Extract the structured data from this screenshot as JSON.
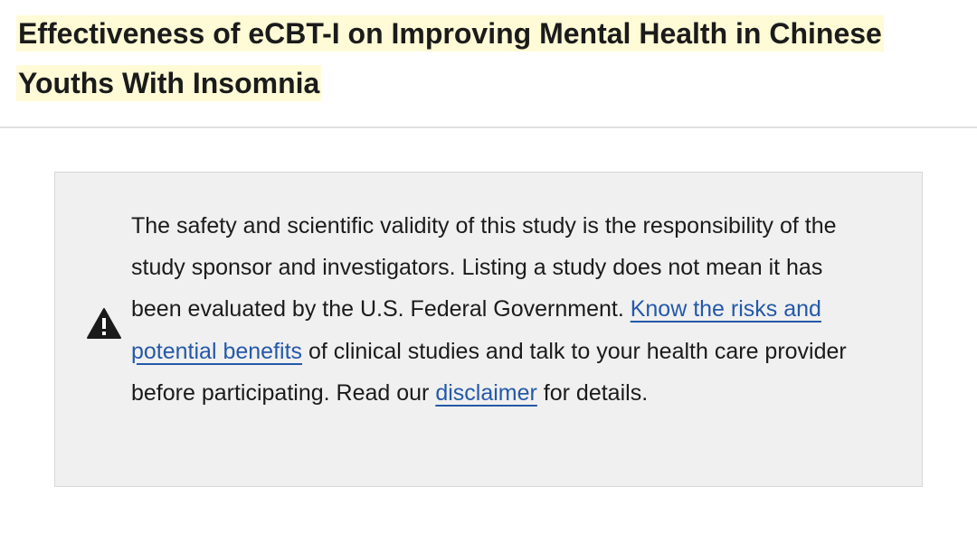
{
  "study": {
    "title_line1": "Effectiveness of eCBT-I on Improving Mental Health in Chinese",
    "title_line2": "Youths With Insomnia"
  },
  "alert": {
    "icon": "warning-triangle-icon",
    "text_part1": "The safety and scientific validity of this study is the responsibility of the study sponsor and investigators. Listing a study does not mean it has been evaluated by the U.S. Federal Government. ",
    "risks_link": "Know the risks and potential benefits",
    "text_part2": " of clinical studies and talk to your health care provider before participating. Read our ",
    "disclaimer_link": "disclaimer",
    "text_part3": " for details."
  },
  "colors": {
    "title_highlight": "#fefbd6",
    "alert_background": "#f0f0f0",
    "link": "#2459a9"
  }
}
